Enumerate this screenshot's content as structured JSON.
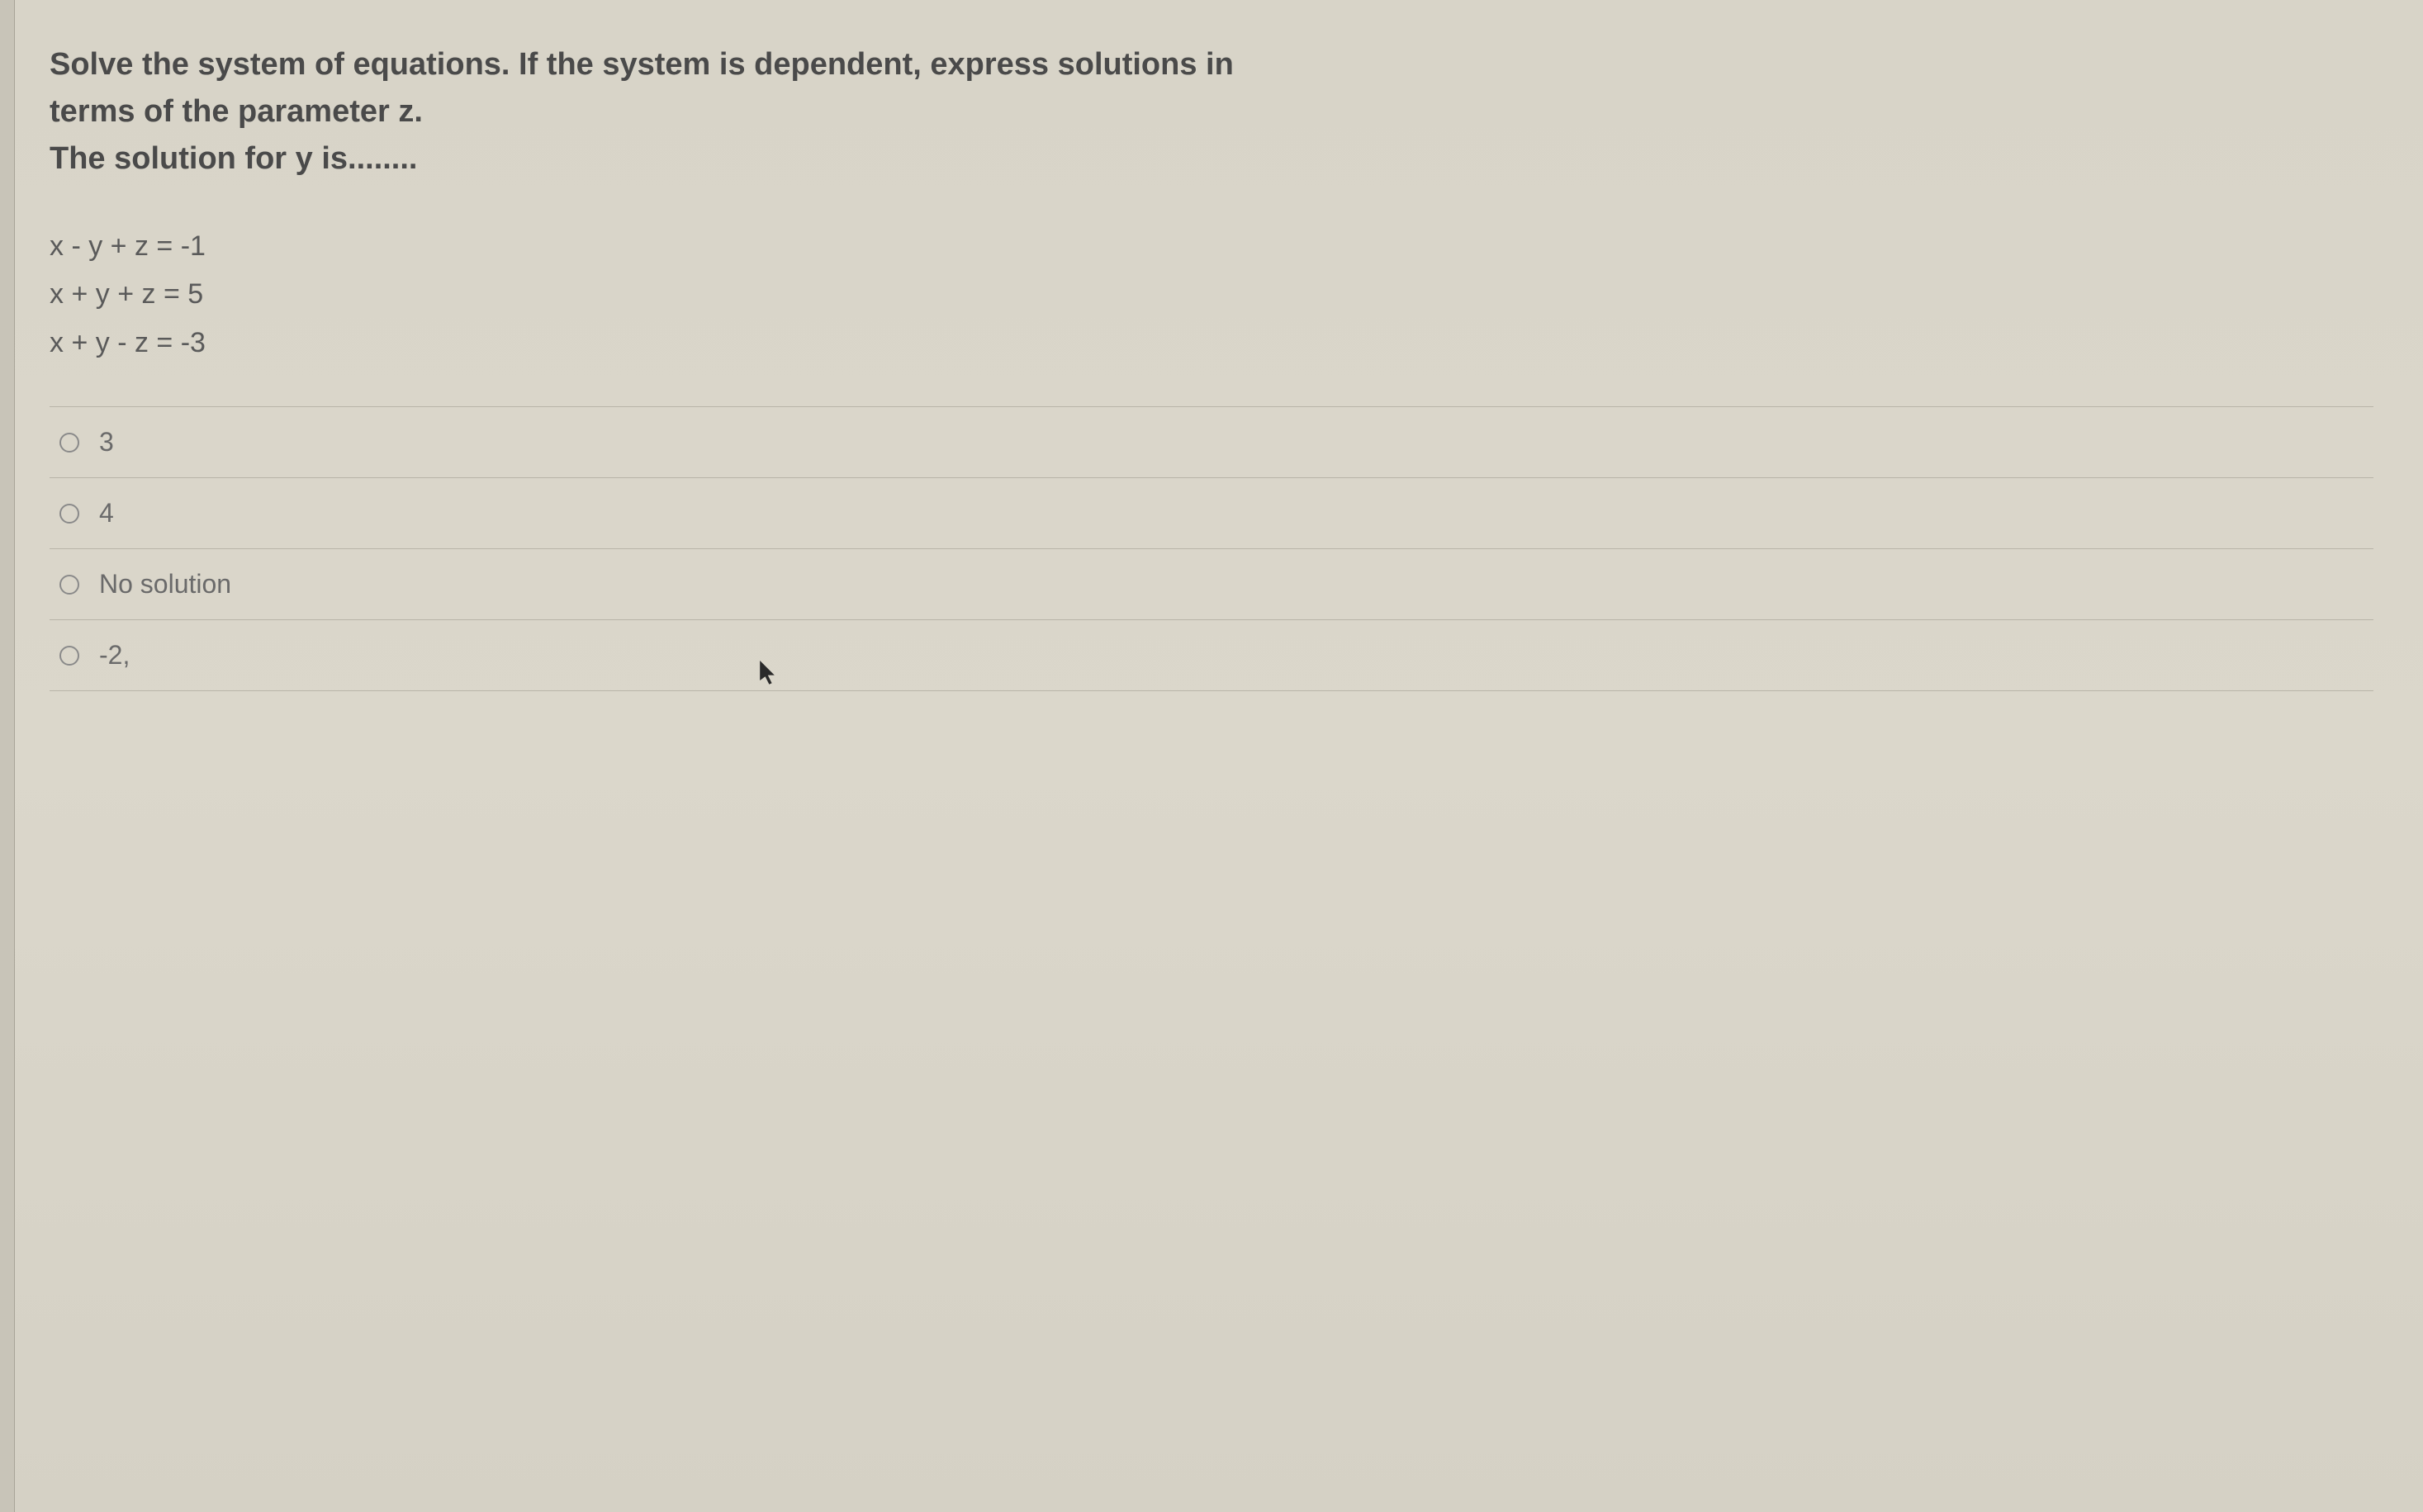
{
  "question": {
    "prompt_line1": "Solve the system of equations. If the system is dependent, express solutions in",
    "prompt_line2": "terms of the parameter z.",
    "prompt_line3": "The solution for y is........"
  },
  "equations": {
    "eq1": "x - y + z = -1",
    "eq2": "x + y + z = 5",
    "eq3": "x + y - z = -3"
  },
  "options": [
    {
      "label": "3"
    },
    {
      "label": "4"
    },
    {
      "label": "No solution"
    },
    {
      "label": "-2,"
    }
  ]
}
